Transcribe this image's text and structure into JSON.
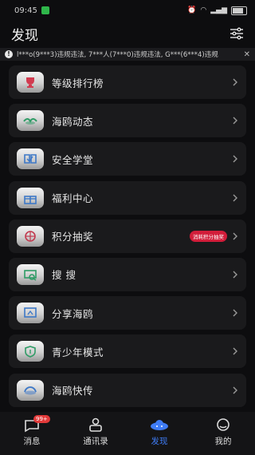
{
  "status": {
    "time": "09:45"
  },
  "header": {
    "title": "发现"
  },
  "notice": {
    "text": "l***o(9***3)违规违法, 7***人(7***0)违规违法, G***(6***4)违规"
  },
  "colors": {
    "accent": "#3f7cf5",
    "badge": "#d21d3a",
    "card": "#1a1a1c"
  },
  "menu": [
    {
      "label": "等级排行榜",
      "icon": "trophy-icon",
      "tint": "#d23b50"
    },
    {
      "label": "海鸥动态",
      "icon": "gull-icon",
      "tint": "#2f9c66"
    },
    {
      "label": "安全学堂",
      "icon": "book-icon",
      "tint": "#3d78c7"
    },
    {
      "label": "福利中心",
      "icon": "gift-icon",
      "tint": "#3d78c7"
    },
    {
      "label": "积分抽奖",
      "icon": "lottery-icon",
      "tint": "#c23a4f",
      "badge": "消耗积分抽奖"
    },
    {
      "label": "搜 搜",
      "icon": "search-icon",
      "tint": "#2f9c66"
    },
    {
      "label": "分享海鸥",
      "icon": "share-icon",
      "tint": "#3d78c7"
    },
    {
      "label": "青少年模式",
      "icon": "shield-icon",
      "tint": "#2f9c66"
    },
    {
      "label": "海鸥快传",
      "icon": "transfer-icon",
      "tint": "#3d78c7"
    }
  ],
  "tabs": [
    {
      "label": "消息",
      "badge": "99+"
    },
    {
      "label": "通讯录"
    },
    {
      "label": "发现",
      "active": true
    },
    {
      "label": "我的"
    }
  ]
}
